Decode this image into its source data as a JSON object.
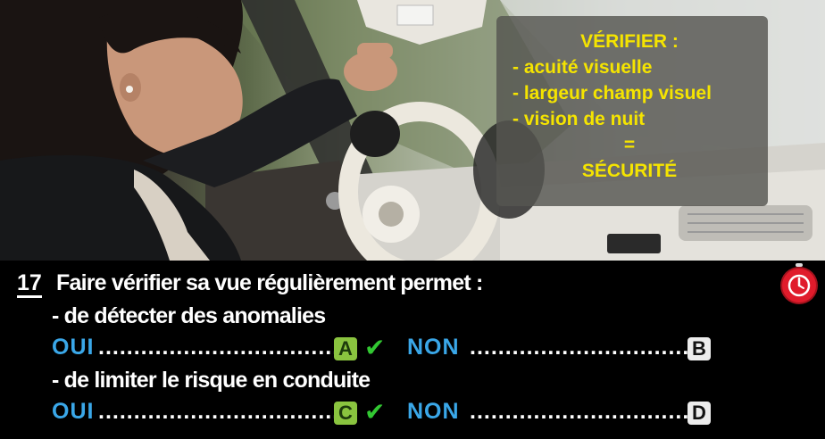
{
  "overlay": {
    "title": "VÉRIFIER :",
    "items": [
      "- acuité visuelle",
      "- largeur champ visuel",
      "- vision de nuit"
    ],
    "equals": "=",
    "result": "SÉCURITÉ"
  },
  "question": {
    "number": "17",
    "text": "Faire vérifier sa vue régulièrement permet :",
    "sub1": "- de détecter des anomalies",
    "sub2": "- de limiter le risque en conduite",
    "row1": {
      "oui": "OUI",
      "dots_left": "..................................",
      "letter_left": "A",
      "check": "✔",
      "non": "NON",
      "dots_right": "..................................",
      "letter_right": "B"
    },
    "row2": {
      "oui": "OUI",
      "dots_left": "..................................",
      "letter_left": "C",
      "check": "✔",
      "non": "NON",
      "dots_right": "..................................",
      "letter_right": "D"
    }
  },
  "colors": {
    "overlay_text": "#f5e400",
    "answer_blue": "#3aa7e8",
    "correct_green": "#8ac43f",
    "check_green": "#32c832",
    "timer_red": "#e01b2b"
  },
  "icons": [
    "stopwatch-icon",
    "checkmark-icon"
  ]
}
